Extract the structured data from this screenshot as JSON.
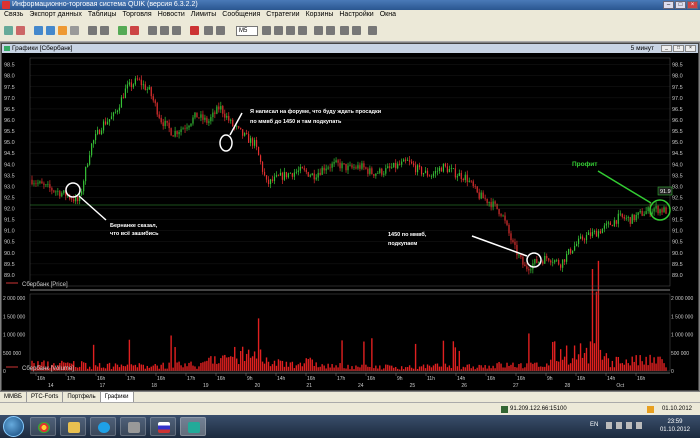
{
  "window": {
    "title": "Информационно-торговая система QUIK (версия 6.3.2.2)"
  },
  "menu": [
    "Связь",
    "Экспорт данных",
    "Таблицы",
    "Торговля",
    "Новости",
    "Лимиты",
    "Сообщения",
    "Стратегии",
    "Корзины",
    "Настройки",
    "Окна"
  ],
  "toolbar": {
    "timeframe_select": "M5"
  },
  "chart_window": {
    "title": "Графики [Сбербанк]",
    "timeframe_label": "5 минут"
  },
  "price_panel": {
    "legend": "Сбербанк [Price]",
    "y_ticks": [
      "98.5",
      "98.0",
      "97.5",
      "97.0",
      "96.5",
      "96.0",
      "95.5",
      "95.0",
      "94.5",
      "94.0",
      "93.5",
      "93.0",
      "92.5",
      "92.0",
      "91.5",
      "91.0",
      "90.5",
      "90.0",
      "89.5",
      "89.0"
    ],
    "current_price_tag": "91.9"
  },
  "volume_panel": {
    "legend": "Сбербанк [Volume]",
    "y_ticks_left": [
      "2 000 000",
      "1 500 000",
      "1 000 000",
      "500 000",
      "0"
    ],
    "y_ticks_right": [
      "2 000 000",
      "1 500 000",
      "1 000 000",
      "500 000",
      "0"
    ]
  },
  "x_axis": {
    "hours": [
      "16h",
      "17h",
      "16h",
      "17h",
      "16h",
      "17h",
      "16h",
      "9h",
      "14h",
      "16h",
      "17h",
      "16h",
      "9h",
      "11h",
      "14h",
      "16h",
      "16h",
      "9h",
      "16h",
      "14h",
      "16h"
    ],
    "days": [
      "14",
      "17",
      "18",
      "19",
      "20",
      "21",
      "24",
      "25",
      "26",
      "27",
      "28",
      "Oct"
    ]
  },
  "annotations": {
    "bernanke": "Бернанке сказал, что всё зашибись",
    "forum": "Я написал на форуме, что буду ждать просадки по ммвб до 1450 и там подкупать",
    "mmvb1450": "1450 по ммвб, подкупаем",
    "profit": "Профит"
  },
  "tabs": [
    "ММВБ",
    "РТС-Forts",
    "Портфель",
    "Графики"
  ],
  "status": {
    "connection": "91.209.122.66:15100",
    "date": "01.10.2012"
  },
  "taskbar": {
    "lang": "EN",
    "time": "23:59",
    "date": "01.10.2012"
  },
  "chart_data": {
    "type": "line",
    "x": [
      "14",
      "17",
      "18",
      "19",
      "20",
      "21",
      "24",
      "25",
      "26",
      "27",
      "28",
      "Oct"
    ],
    "series": [
      {
        "name": "Сбербанк [Price]",
        "values": [
          93.3,
          97.4,
          96.0,
          93.5,
          94.0,
          93.8,
          93.8,
          94.0,
          93.0,
          89.3,
          90.8,
          92.0
        ]
      }
    ],
    "ylim": [
      88.5,
      98.8
    ],
    "volume": [
      400000,
      300000,
      350000,
      900000,
      500000,
      300000,
      250000,
      300000,
      350000,
      1100000,
      600000,
      400000
    ],
    "volume_ylim": [
      0,
      2000000
    ]
  }
}
